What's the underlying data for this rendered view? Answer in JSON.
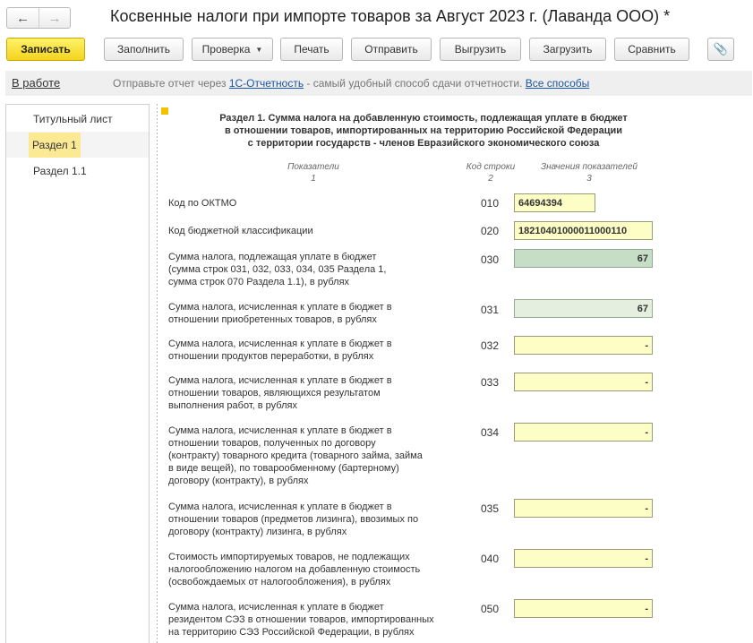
{
  "window": {
    "title": "Косвенные налоги при импорте товаров за Август 2023 г. (Лаванда ООО) *",
    "back": "←",
    "forward": "→"
  },
  "toolbar": {
    "save": "Записать",
    "fill": "Заполнить",
    "check": "Проверка",
    "print": "Печать",
    "send": "Отправить",
    "export": "Выгрузить",
    "import": "Загрузить",
    "compare": "Сравнить",
    "attach": "📎"
  },
  "infobar": {
    "status": "В работе",
    "text_before": "Отправьте отчет через ",
    "link1": "1С-Отчетность",
    "text_after": " - самый удобный способ сдачи отчетности. ",
    "link2": "Все способы"
  },
  "sections": [
    "Титульный лист",
    "Раздел 1",
    "Раздел 1.1"
  ],
  "form": {
    "title_lines": [
      "Раздел 1. Сумма налога на добавленную стоимость, подлежащая уплате в бюджет",
      "в отношении товаров, импортированных на территорию Российской Федерации",
      "с территории государств - членов Евразийского экономического союза"
    ],
    "col_indicators": "Показатели",
    "col_indicators_num": "1",
    "col_code": "Код строки",
    "col_code_num": "2",
    "col_values": "Значения показателей",
    "col_values_num": "3",
    "rows": [
      {
        "label": [
          "Код по ОКТМО"
        ],
        "code": "010",
        "value": "64694394"
      },
      {
        "label": [
          "Код бюджетной классификации"
        ],
        "code": "020",
        "value": "18210401000011000110"
      },
      {
        "label": [
          "Сумма налога, подлежащая уплате в бюджет",
          "(сумма строк 031, 032, 033, 034, 035 Раздела 1,",
          "сумма строк 070 Раздела 1.1), в рублях"
        ],
        "code": "030",
        "value": "67"
      },
      {
        "label": [
          "Сумма налога, исчисленная к уплате в бюджет в",
          "отношении приобретенных товаров, в рублях"
        ],
        "code": "031",
        "value": "67"
      },
      {
        "label": [
          "Сумма налога, исчисленная к уплате в бюджет в",
          "отношении продуктов переработки, в рублях"
        ],
        "code": "032",
        "value": "-"
      },
      {
        "label": [
          "Сумма налога, исчисленная к уплате в бюджет в",
          "отношении товаров, являющихся результатом",
          "выполнения работ, в рублях"
        ],
        "code": "033",
        "value": "-"
      },
      {
        "label": [
          "Сумма налога, исчисленная к уплате в бюджет в",
          "отношении товаров, полученных по договору",
          "(контракту) товарного кредита (товарного займа, займа",
          "в виде вещей), по товарообменному (бартерному)",
          "договору (контракту), в рублях"
        ],
        "code": "034",
        "value": "-"
      },
      {
        "label": [
          "Сумма налога, исчисленная к уплате в бюджет в",
          "отношении товаров (предметов лизинга), ввозимых по",
          "договору (контракту) лизинга, в рублях"
        ],
        "code": "035",
        "value": "-"
      },
      {
        "label": [
          "Стоимость импортируемых товаров, не подлежащих",
          "налогообложению налогом на добавленную стоимость",
          "(освобождаемых от налогообложения), в рублях"
        ],
        "code": "040",
        "value": "-"
      },
      {
        "label": [
          "Сумма налога, исчисленная к уплате в бюджет",
          "резидентом СЭЗ в отношении товаров, импортированных",
          "на территорию СЭЗ Российской Федерации, в рублях"
        ],
        "code": "050",
        "value": "-"
      }
    ]
  }
}
